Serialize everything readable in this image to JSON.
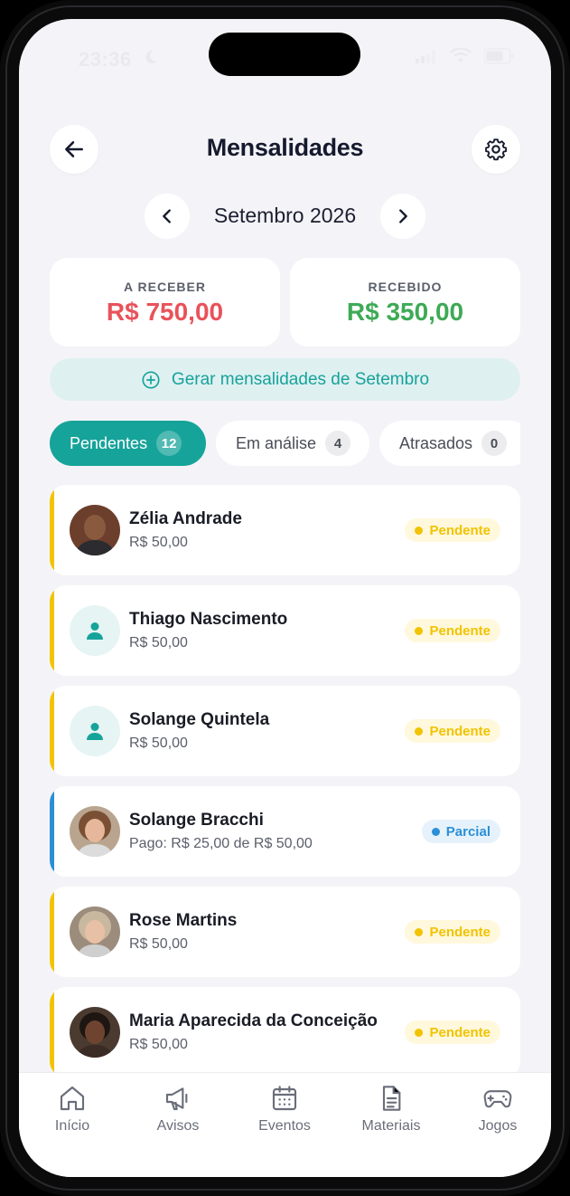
{
  "status_bar": {
    "time": "23:36"
  },
  "header": {
    "title": "Mensalidades"
  },
  "month": {
    "label": "Setembro 2026"
  },
  "summary": {
    "to_receive": {
      "label": "A RECEBER",
      "value": "R$ 750,00",
      "color": "#e9525a"
    },
    "received": {
      "label": "RECEBIDO",
      "value": "R$ 350,00",
      "color": "#3eaa56"
    }
  },
  "generate_button": {
    "label": "Gerar mensalidades de Setembro"
  },
  "tabs": [
    {
      "label": "Pendentes",
      "count": "12",
      "active": true
    },
    {
      "label": "Em análise",
      "count": "4",
      "active": false
    },
    {
      "label": "Atrasados",
      "count": "0",
      "active": false
    }
  ],
  "items": [
    {
      "name": "Zélia Andrade",
      "amount": "R$ 50,00",
      "status": "Pendente",
      "avatar": "photo-dark"
    },
    {
      "name": "Thiago Nascimento",
      "amount": "R$ 50,00",
      "status": "Pendente",
      "avatar": "placeholder"
    },
    {
      "name": "Solange Quintela",
      "amount": "R$ 50,00",
      "status": "Pendente",
      "avatar": "placeholder"
    },
    {
      "name": "Solange Bracchi",
      "amount": "Pago: R$ 25,00 de R$ 50,00",
      "status": "Parcial",
      "avatar": "photo-light"
    },
    {
      "name": "Rose Martins",
      "amount": "R$ 50,00",
      "status": "Pendente",
      "avatar": "photo-grey"
    },
    {
      "name": "Maria Aparecida da Conceição",
      "amount": "R$ 50,00",
      "status": "Pendente",
      "avatar": "photo-dark2"
    }
  ],
  "colors": {
    "accent": "#16a39a",
    "pending": "#f2c300",
    "partial": "#2b8fd6"
  },
  "bottom_nav": [
    {
      "label": "Início",
      "icon": "home-icon"
    },
    {
      "label": "Avisos",
      "icon": "megaphone-icon"
    },
    {
      "label": "Eventos",
      "icon": "calendar-icon"
    },
    {
      "label": "Materiais",
      "icon": "document-icon"
    },
    {
      "label": "Jogos",
      "icon": "gamepad-icon"
    }
  ]
}
